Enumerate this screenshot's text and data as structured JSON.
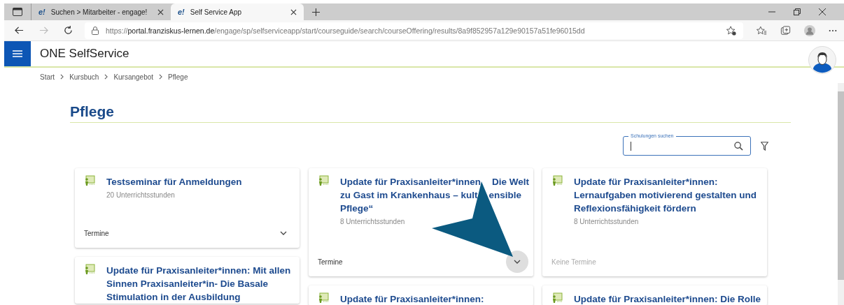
{
  "browser": {
    "tabs": [
      {
        "title": "Suchen > Mitarbeiter - engage!",
        "logo": "e!",
        "selected": false
      },
      {
        "title": "Self Service App",
        "logo": "e!",
        "selected": true
      }
    ],
    "url": {
      "scheme": "https://",
      "host": "portal.franziskus-lernen.de",
      "path": "/engage/sp/selfserviceapp/start/courseguide/search/courseOffering/results/8a9f852957a129e90157a51fe96015dd"
    }
  },
  "app": {
    "title": "ONE SelfService"
  },
  "breadcrumb": [
    "Start",
    "Kursbuch",
    "Kursangebot",
    "Pflege"
  ],
  "page": {
    "title": "Pflege"
  },
  "search": {
    "label": "Schulungen suchen"
  },
  "columns": [
    [
      {
        "title_lines": [
          [
            "Testseminar für Anmeldungen"
          ]
        ],
        "hours": "20 Unterrichtsstunden",
        "footer": {
          "label": "Termine",
          "kind": "dates",
          "highlighted": false
        }
      },
      {
        "title_lines": [
          [
            "Update für Praxisanleiter*innen: Mit allen"
          ],
          [
            "Sinnen Praxisanleiter*in- Die Basale"
          ],
          [
            "Stimulation in der Ausbildung"
          ]
        ]
      }
    ],
    [
      {
        "title_lines": [
          [
            "Update für Praxisanleiter*innen",
            "Die Welt"
          ],
          [
            "zu Gast im Krankenhaus – kult",
            "ensible"
          ],
          [
            "Pflege“"
          ]
        ],
        "hours": "8 Unterrichtsstunden",
        "footer": {
          "label": "Termine",
          "kind": "dates",
          "highlighted": true
        }
      },
      {
        "title_lines": [
          [
            "Update für Praxisanleiter*innen:"
          ]
        ]
      }
    ],
    [
      {
        "title_lines": [
          [
            "Update für Praxisanleiter*innen:"
          ],
          [
            "Lernaufgaben motivierend gestalten und"
          ],
          [
            "Reflexionsfähigkeit fördern"
          ]
        ],
        "hours": "8 Unterrichtsstunden",
        "footer": {
          "label": "Keine Termine",
          "kind": "none"
        }
      },
      {
        "title_lines": [
          [
            "Update für Praxisanleiter*innen: Die Rolle"
          ]
        ]
      }
    ]
  ]
}
